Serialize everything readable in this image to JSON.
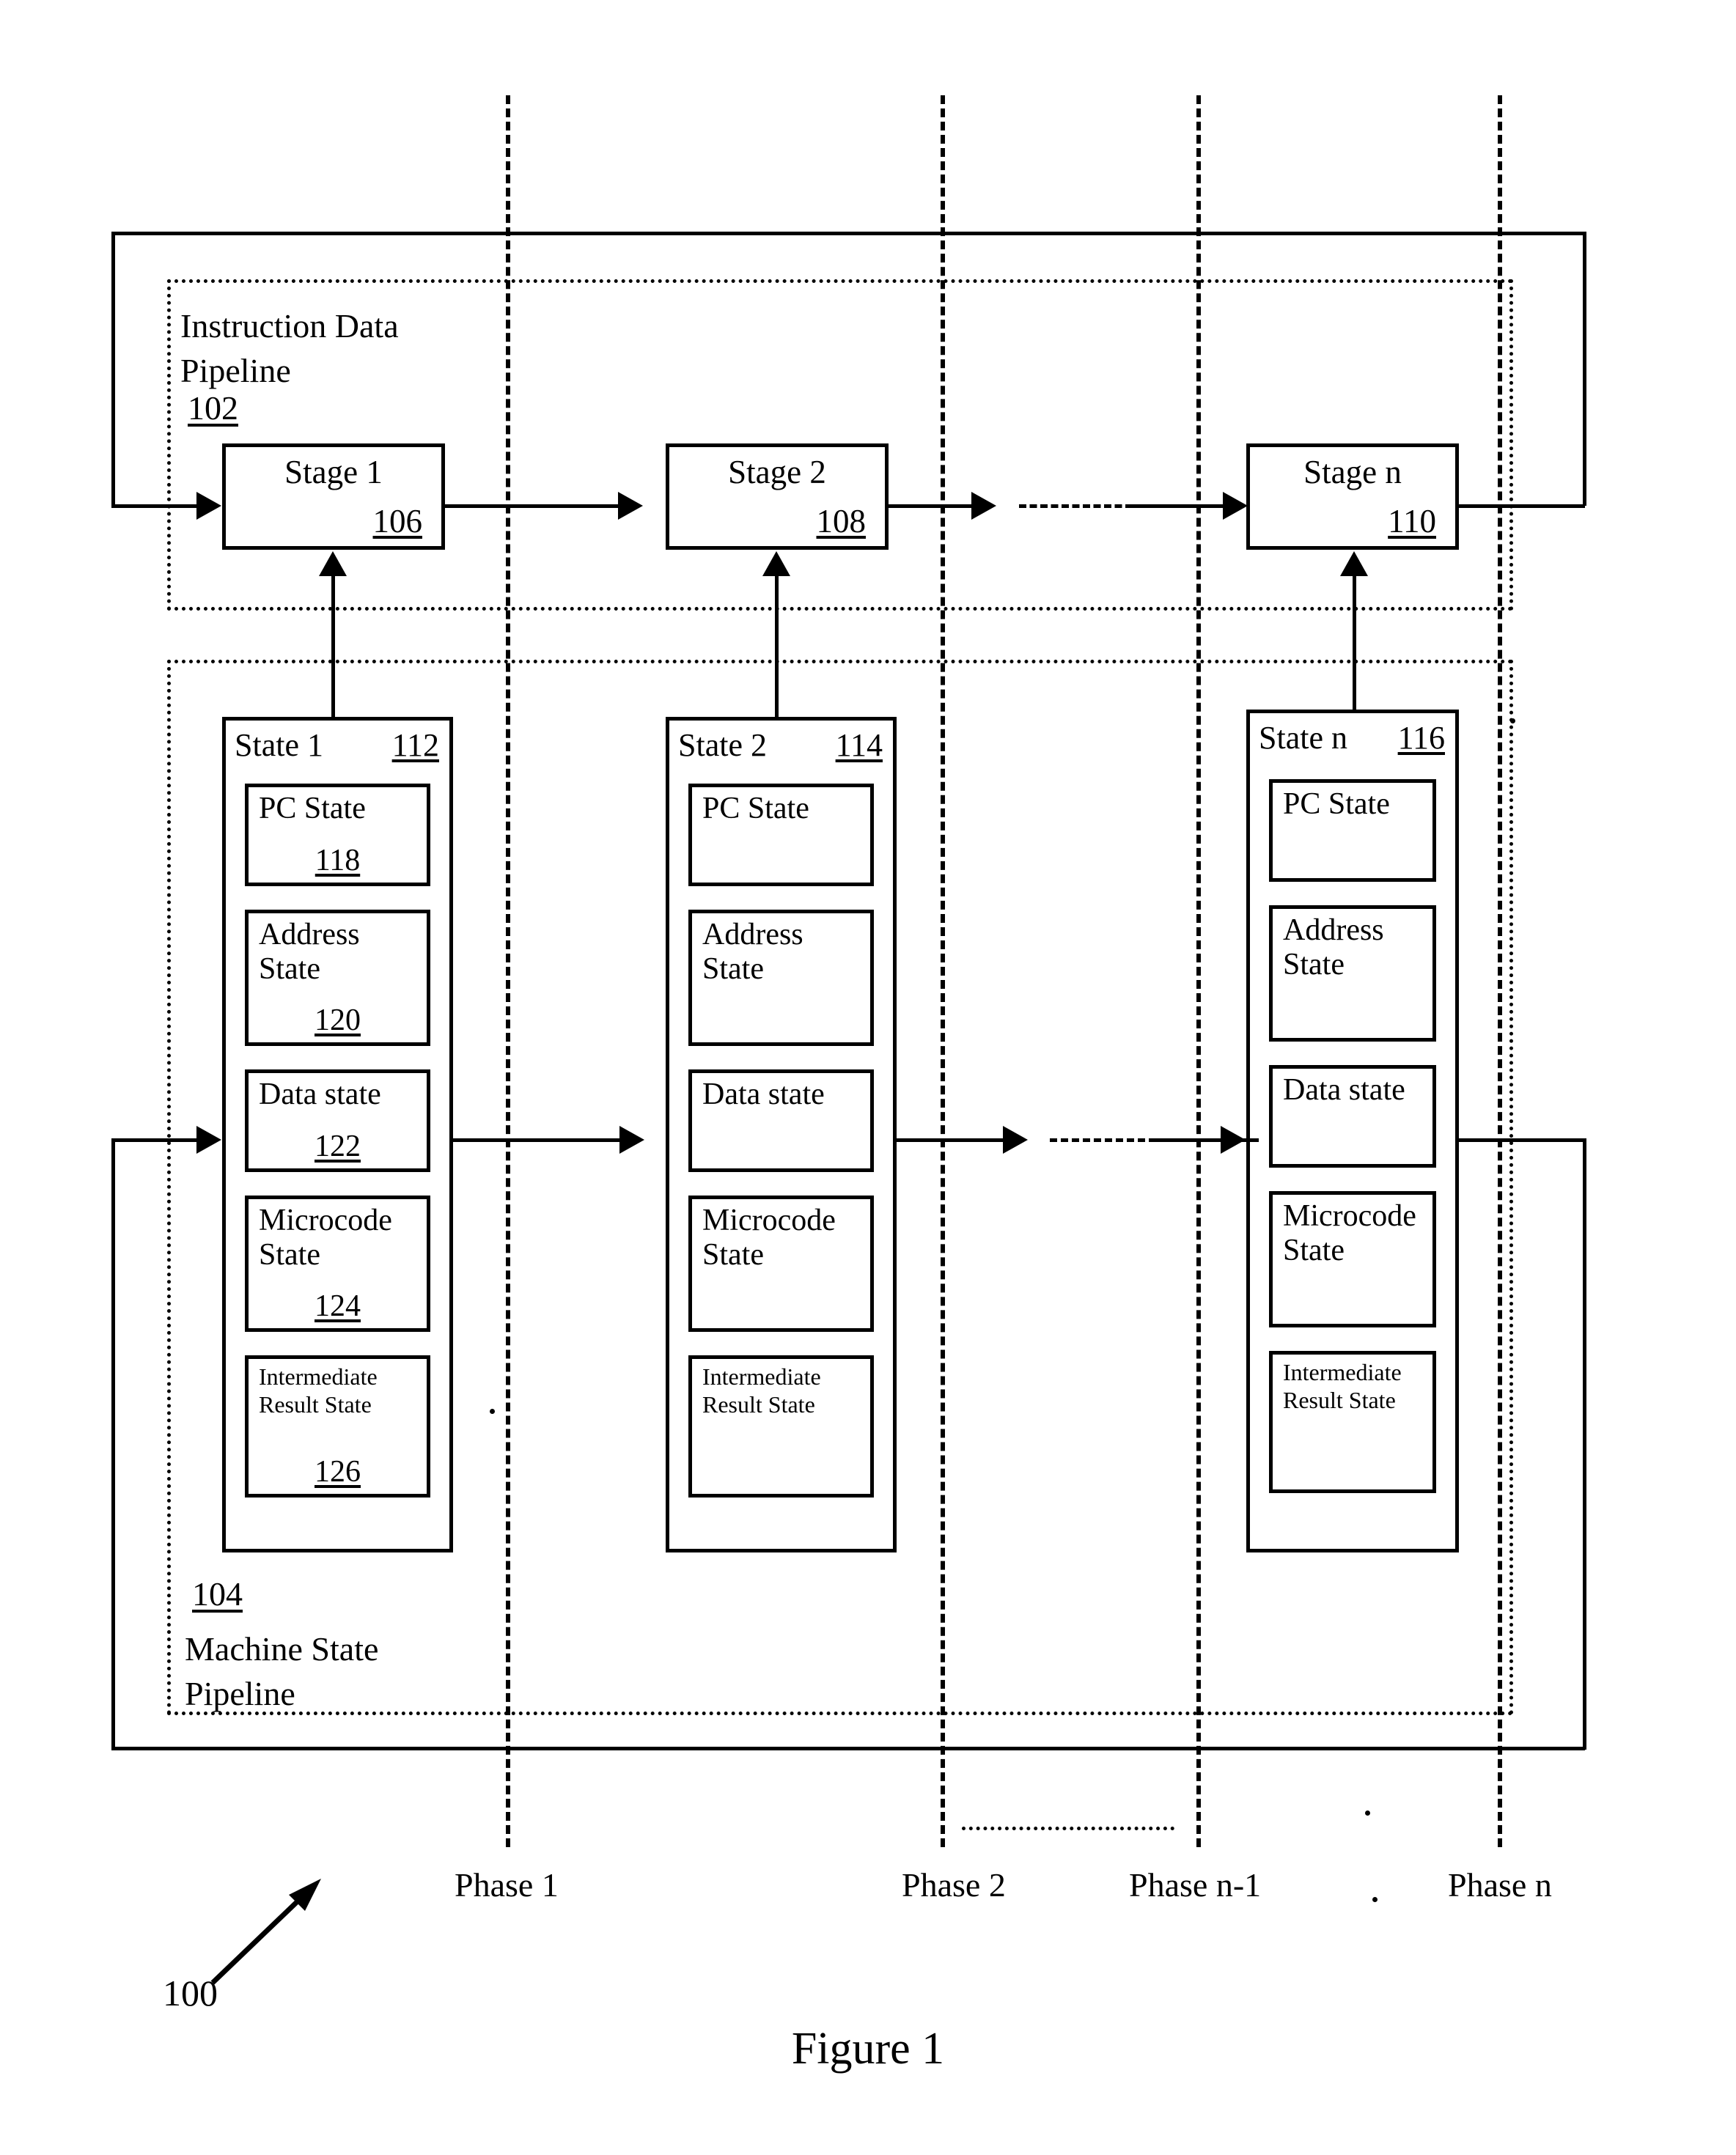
{
  "figure": {
    "caption": "Figure 1",
    "overall_ref": "100"
  },
  "pipelines": [
    {
      "id": "instruction-data-pipeline",
      "label": "Instruction Data\nPipeline",
      "ref": "102"
    },
    {
      "id": "machine-state-pipeline",
      "label": "Machine State\nPipeline",
      "ref": "104"
    }
  ],
  "stages": [
    {
      "title": "Stage 1",
      "ref": "106"
    },
    {
      "title": "Stage 2",
      "ref": "108"
    },
    {
      "title": "Stage n",
      "ref": "110"
    }
  ],
  "states": [
    {
      "title": "State 1",
      "ref": "112",
      "substates": [
        {
          "label": "PC State",
          "ref": "118"
        },
        {
          "label": "Address\nState",
          "ref": "120"
        },
        {
          "label": "Data state",
          "ref": "122"
        },
        {
          "label": "Microcode\nState",
          "ref": "124"
        },
        {
          "label": "Intermediate\nResult State",
          "ref": "126"
        }
      ]
    },
    {
      "title": "State 2",
      "ref": "114",
      "substates": [
        {
          "label": "PC State",
          "ref": ""
        },
        {
          "label": "Address\nState",
          "ref": ""
        },
        {
          "label": "Data state",
          "ref": ""
        },
        {
          "label": "Microcode\nState",
          "ref": ""
        },
        {
          "label": "Intermediate\nResult State",
          "ref": ""
        }
      ]
    },
    {
      "title": "State n",
      "ref": "116",
      "substates": [
        {
          "label": "PC State",
          "ref": ""
        },
        {
          "label": "Address\nState",
          "ref": ""
        },
        {
          "label": "Data state",
          "ref": ""
        },
        {
          "label": "Microcode\nState",
          "ref": ""
        },
        {
          "label": "Intermediate\nResult State",
          "ref": ""
        }
      ]
    }
  ],
  "phases": [
    {
      "label": "Phase 1"
    },
    {
      "label": "Phase 2"
    },
    {
      "label": "Phase n-1"
    },
    {
      "label": "Phase n"
    }
  ],
  "colors": {
    "ink": "#000000",
    "paper": "#ffffff"
  }
}
